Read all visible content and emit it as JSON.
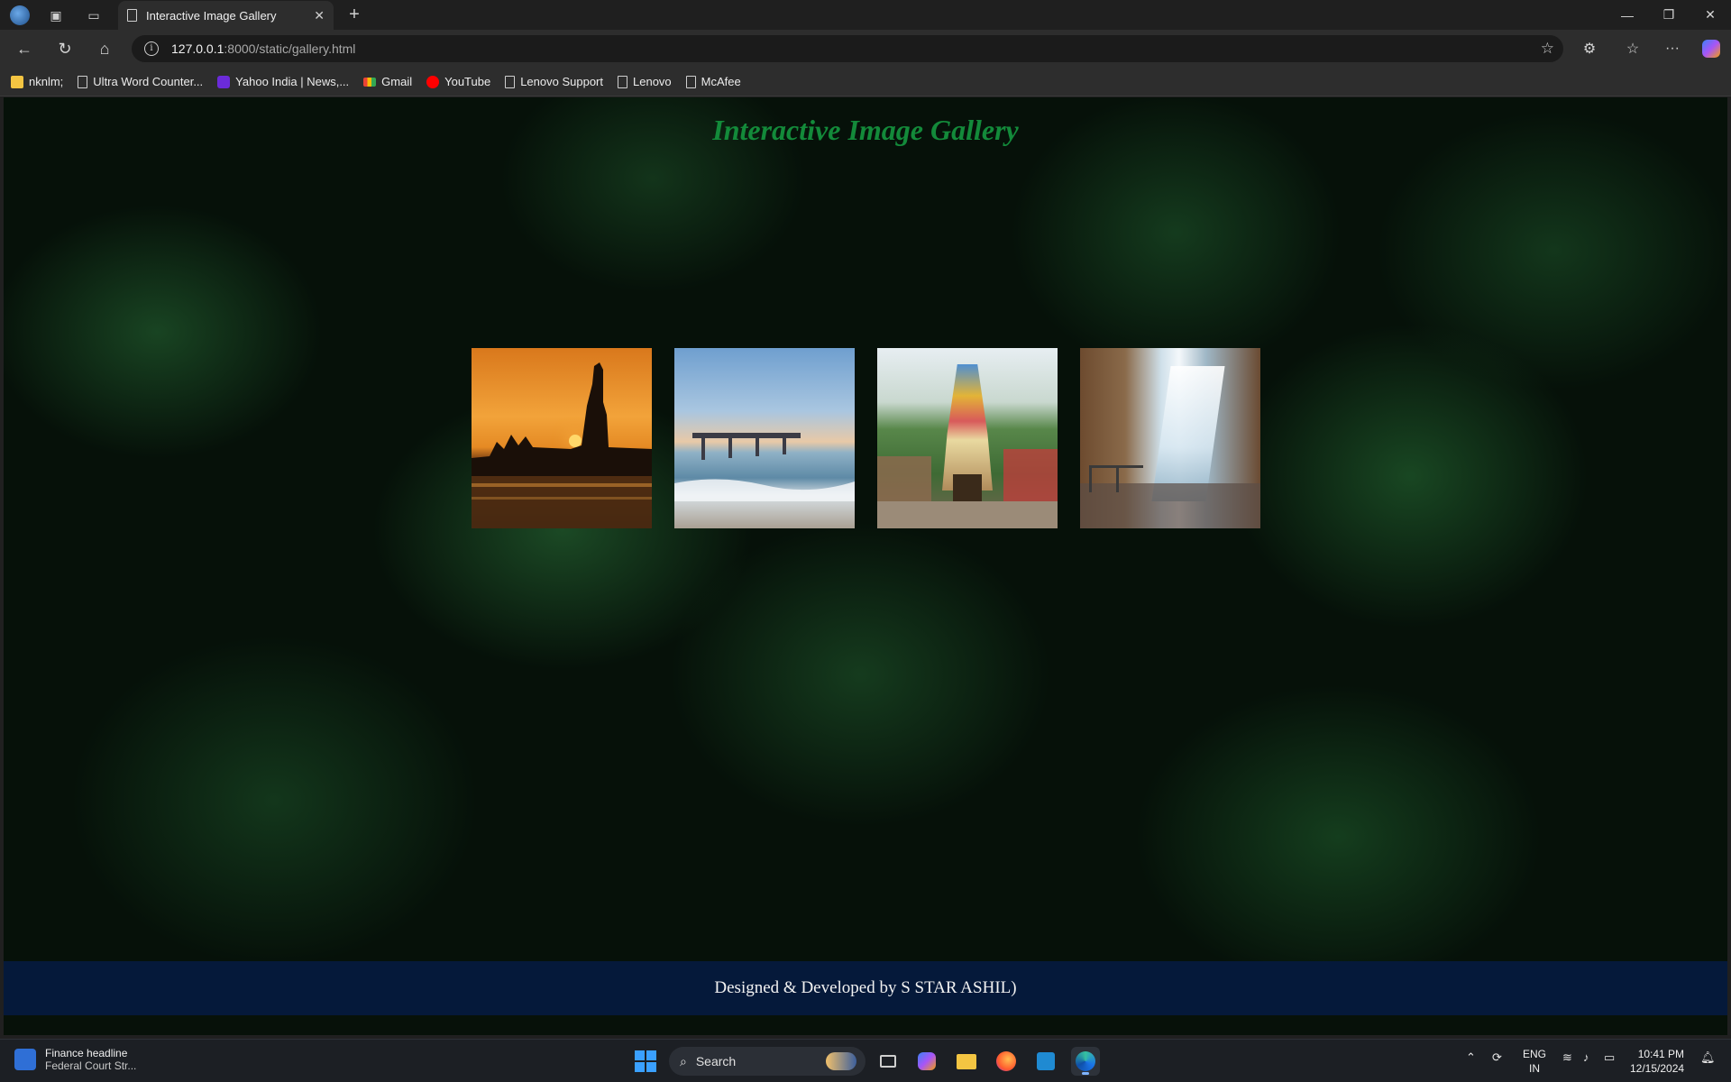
{
  "browser": {
    "tab_title": "Interactive Image Gallery",
    "address_host": "127.0.0.1",
    "address_path": ":8000/static/gallery.html",
    "bookmarks": [
      {
        "label": "nknlm;",
        "icon": "folder-icon"
      },
      {
        "label": "Ultra Word Counter...",
        "icon": "page-icon"
      },
      {
        "label": "Yahoo India | News,...",
        "icon": "yahoo-icon"
      },
      {
        "label": "Gmail",
        "icon": "gmail-icon"
      },
      {
        "label": "YouTube",
        "icon": "youtube-icon"
      },
      {
        "label": "Lenovo Support",
        "icon": "page-icon"
      },
      {
        "label": "Lenovo",
        "icon": "page-icon"
      },
      {
        "label": "McAfee",
        "icon": "page-icon"
      }
    ]
  },
  "page": {
    "title": "Interactive Image Gallery",
    "title_color": "#138a3a",
    "gallery": [
      {
        "name": "sunset-statue-photo"
      },
      {
        "name": "beach-pier-photo"
      },
      {
        "name": "temple-photo"
      },
      {
        "name": "waterfall-photo"
      }
    ],
    "footer": "Designed & Developed by S STAR ASHIL)",
    "footer_bg": "#05193a"
  },
  "taskbar": {
    "news_title": "Finance headline",
    "news_sub": "Federal Court Str...",
    "search_placeholder": "Search",
    "lang_top": "ENG",
    "lang_bottom": "IN",
    "time": "10:41 PM",
    "date": "12/15/2024"
  }
}
